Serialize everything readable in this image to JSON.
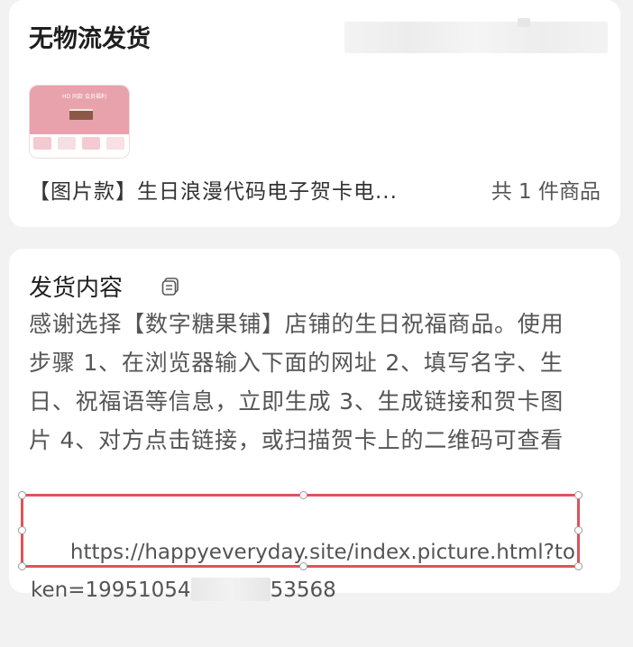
{
  "shipping": {
    "title": "无物流发货",
    "product_title": "【图片款】生日浪漫代码电子贺卡电...",
    "product_count": "共 1 件商品",
    "thumbnail": {
      "caption": "HD 同款 会员福利"
    }
  },
  "content": {
    "title": "发货内容",
    "copy_icon": "copy-icon",
    "description": "感谢选择【数字糖果铺】店铺的生日祝福商品。使用步骤 1、在浏览器输入下面的网址 2、填写名字、生日、祝福语等信息，立即生成 3、生成链接和贺卡图片 4、对方点击链接，或扫描贺卡上的二维码可查看",
    "link_start": "https://happyeveryday.site/index.picture.html?token=19951054",
    "link_end": "53568"
  },
  "colors": {
    "background": "#f2f2f2",
    "card": "#ffffff",
    "highlight_border": "#e0525a",
    "thumb_pink": "#e8a2ac"
  }
}
